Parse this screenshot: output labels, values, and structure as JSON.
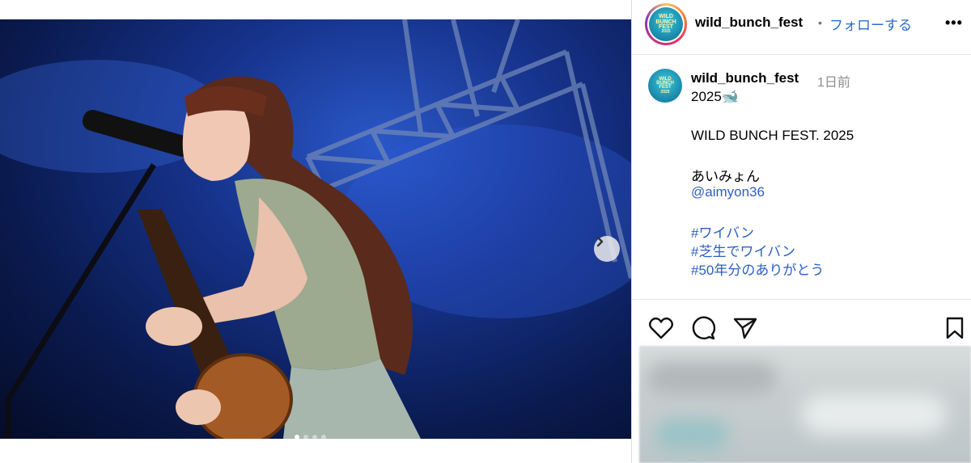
{
  "post": {
    "username": "wild_bunch_fest",
    "separator": "•",
    "follow_label": "フォローする",
    "more_label": "•••",
    "time_ago": "1日前",
    "avatar_text": [
      "WILD",
      "BUNCH",
      "FEST",
      "2025"
    ],
    "caption_lines": [
      {
        "text": "2025🐋",
        "type": "text"
      },
      {
        "text": "WILD BUNCH FEST. 2025",
        "type": "text"
      },
      {
        "text": "あいみょん",
        "type": "text"
      },
      {
        "text": "@aimyon36",
        "type": "mention"
      },
      {
        "text": "#ワイバン",
        "type": "hashtag"
      },
      {
        "text": "#芝生でワイバン",
        "type": "hashtag"
      },
      {
        "text": "#50年分のありがとう",
        "type": "hashtag"
      }
    ]
  },
  "media": {
    "carousel_count": 4,
    "carousel_active_index": 0,
    "next_icon": "chevron-right-icon"
  },
  "actions": {
    "icons": [
      "heart-icon",
      "comment-icon",
      "share-icon",
      "bookmark-icon"
    ]
  },
  "colors": {
    "link": "#2d5fc4",
    "stage_blue": "#16328a"
  }
}
